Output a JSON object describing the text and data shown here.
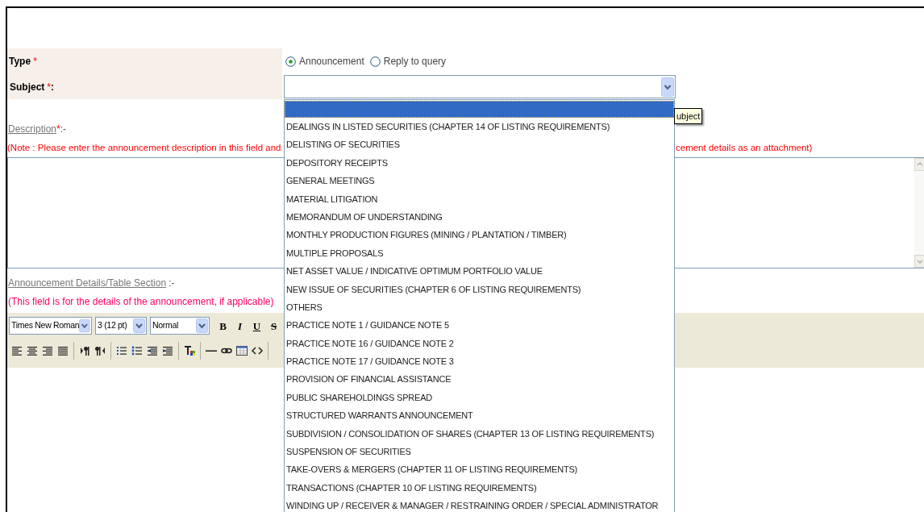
{
  "type_field": {
    "label": "Type",
    "required_mark": "*",
    "options": [
      {
        "label": "Announcement",
        "selected": true
      },
      {
        "label": "Reply to query",
        "selected": false
      }
    ]
  },
  "subject_field": {
    "label": "Subject",
    "required_mark": "*",
    "suffix": ":",
    "dropdown": {
      "expanded": true,
      "blank_option_highlighted": true,
      "options": [
        "DEALINGS IN LISTED SECURITIES (CHAPTER 14 OF LISTING REQUIREMENTS)",
        "DELISTING OF SECURITIES",
        "DEPOSITORY RECEIPTS",
        "GENERAL MEETINGS",
        "MATERIAL LITIGATION",
        "MEMORANDUM OF UNDERSTANDING",
        "MONTHLY PRODUCTION FIGURES (MINING / PLANTATION / TIMBER)",
        "MULTIPLE PROPOSALS",
        "NET ASSET VALUE / INDICATIVE OPTIMUM PORTFOLIO VALUE",
        "NEW ISSUE OF SECURITIES (CHAPTER 6 OF LISTING REQUIREMENTS)",
        "OTHERS",
        "PRACTICE NOTE 1 / GUIDANCE NOTE 5",
        "PRACTICE NOTE 16 / GUIDANCE NOTE 2",
        "PRACTICE NOTE 17 / GUIDANCE NOTE 3",
        "PROVISION OF FINANCIAL ASSISTANCE",
        "PUBLIC SHAREHOLDINGS SPREAD",
        "STRUCTURED WARRANTS ANNOUNCEMENT",
        "SUBDIVISION / CONSOLIDATION OF SHARES (CHAPTER 13 OF LISTING REQUIREMENTS)",
        "SUSPENSION OF SECURITIES",
        "TAKE-OVERS & MERGERS (CHAPTER 11 OF LISTING REQUIREMENTS)",
        "TRANSACTIONS (CHAPTER 10 OF LISTING REQUIREMENTS)",
        "WINDING UP / RECEIVER & MANAGER / RESTRAINING ORDER / SPECIAL ADMINISTRATOR"
      ]
    },
    "tooltip": "ubject"
  },
  "description": {
    "label": "Description",
    "required_mark": "*",
    "suffix": ":-",
    "note_left": "(Note : Please enter the announcement description in this field and",
    "note_right": "cement details as an attachment)"
  },
  "details": {
    "label": "Announcement Details/Table Section",
    "suffix": ":-",
    "note": "(This field is for the details of the announcement, if applicable)",
    "toolbar": {
      "font": "Times New Roman",
      "size": "3 (12 pt)",
      "format": "Normal",
      "buttons": [
        {
          "kind": "bold",
          "label": "B"
        },
        {
          "kind": "italic",
          "label": "I"
        },
        {
          "kind": "underline",
          "label": "U"
        },
        {
          "kind": "strike",
          "label": "S"
        }
      ]
    }
  }
}
